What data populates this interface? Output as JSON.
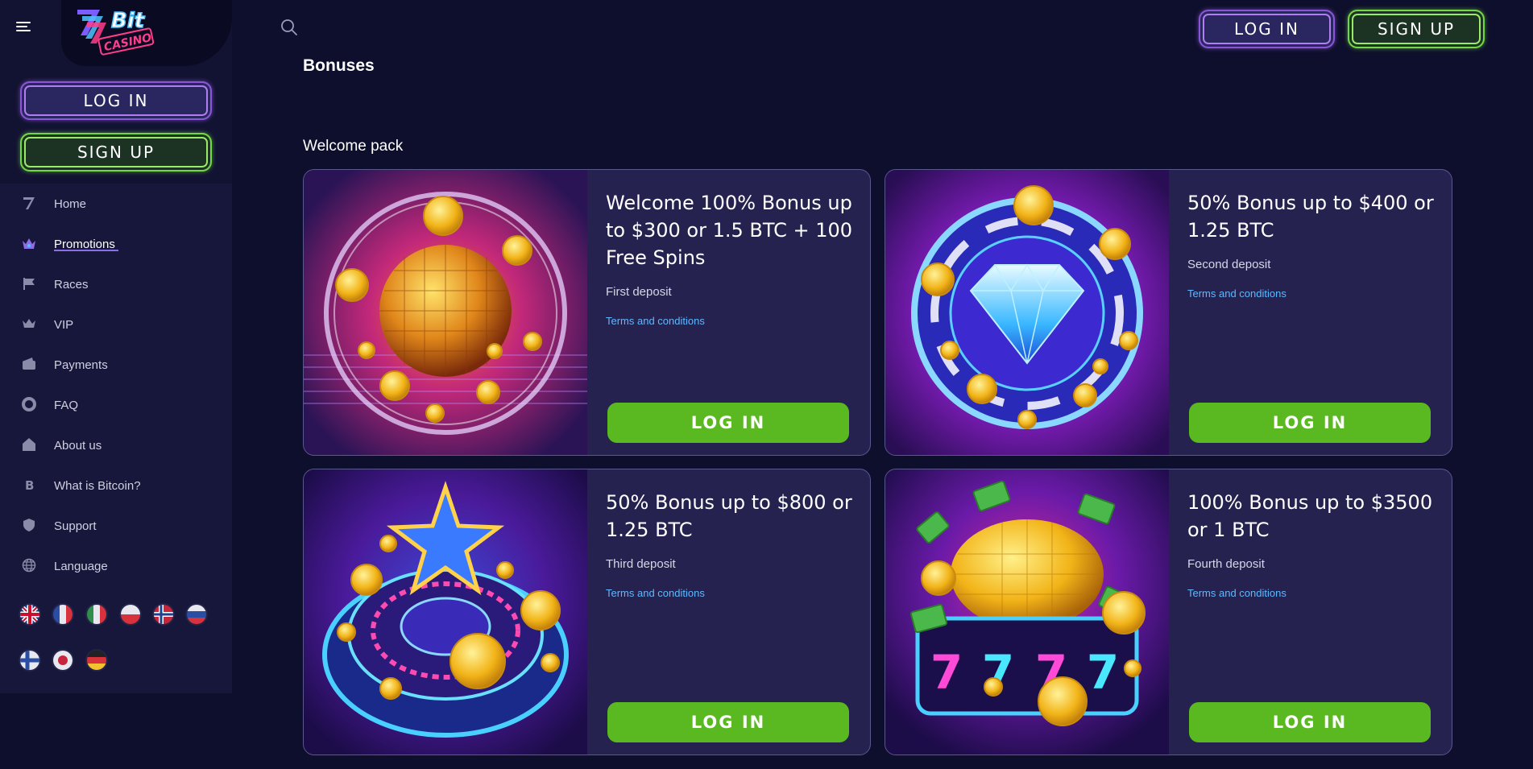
{
  "header": {
    "login_label": "LOG IN",
    "signup_label": "SIGN UP"
  },
  "sidebar": {
    "logo_text_top": "Bit",
    "logo_text_bottom": "CASINO",
    "login_label": "LOG IN",
    "signup_label": "SIGN UP",
    "items": [
      {
        "label": "Home",
        "icon": "logo-7-icon"
      },
      {
        "label": "Promotions",
        "icon": "promotions-icon",
        "active": true
      },
      {
        "label": "Races",
        "icon": "flag-icon"
      },
      {
        "label": "VIP",
        "icon": "crown-icon"
      },
      {
        "label": "Payments",
        "icon": "wallet-icon"
      },
      {
        "label": "FAQ",
        "icon": "lifebuoy-icon"
      },
      {
        "label": "About us",
        "icon": "home-icon"
      },
      {
        "label": "What is Bitcoin?",
        "icon": "bitcoin-icon"
      },
      {
        "label": "Support",
        "icon": "shield-icon"
      },
      {
        "label": "Language",
        "icon": "globe-icon"
      }
    ],
    "flags": [
      "gb",
      "fr",
      "it",
      "pl",
      "no",
      "ru",
      "fi",
      "jp",
      "de"
    ]
  },
  "main": {
    "page_title": "Bonuses",
    "section_title": "Welcome pack",
    "cards": [
      {
        "title": "Welcome 100% Bonus up to $300 or 1.5 BTC + 100 Free Spins",
        "subtitle": "First deposit",
        "terms": "Terms and conditions",
        "button": "LOG IN"
      },
      {
        "title": "50% Bonus up to $400 or 1.25 BTC",
        "subtitle": "Second deposit",
        "terms": "Terms and conditions",
        "button": "LOG IN"
      },
      {
        "title": "50% Bonus up to $800 or 1.25 BTC",
        "subtitle": "Third deposit",
        "terms": "Terms and conditions",
        "button": "LOG IN"
      },
      {
        "title": "100% Bonus up to $3500 or 1 BTC",
        "subtitle": "Fourth deposit",
        "terms": "Terms and conditions",
        "button": "LOG IN"
      }
    ]
  },
  "colors": {
    "background": "#0e0f2c",
    "sidebar": "#16173a",
    "card": "#25224f",
    "accent_green": "#5ab821",
    "link_blue": "#5fb8ff",
    "login_purple": "#8a55d8"
  }
}
